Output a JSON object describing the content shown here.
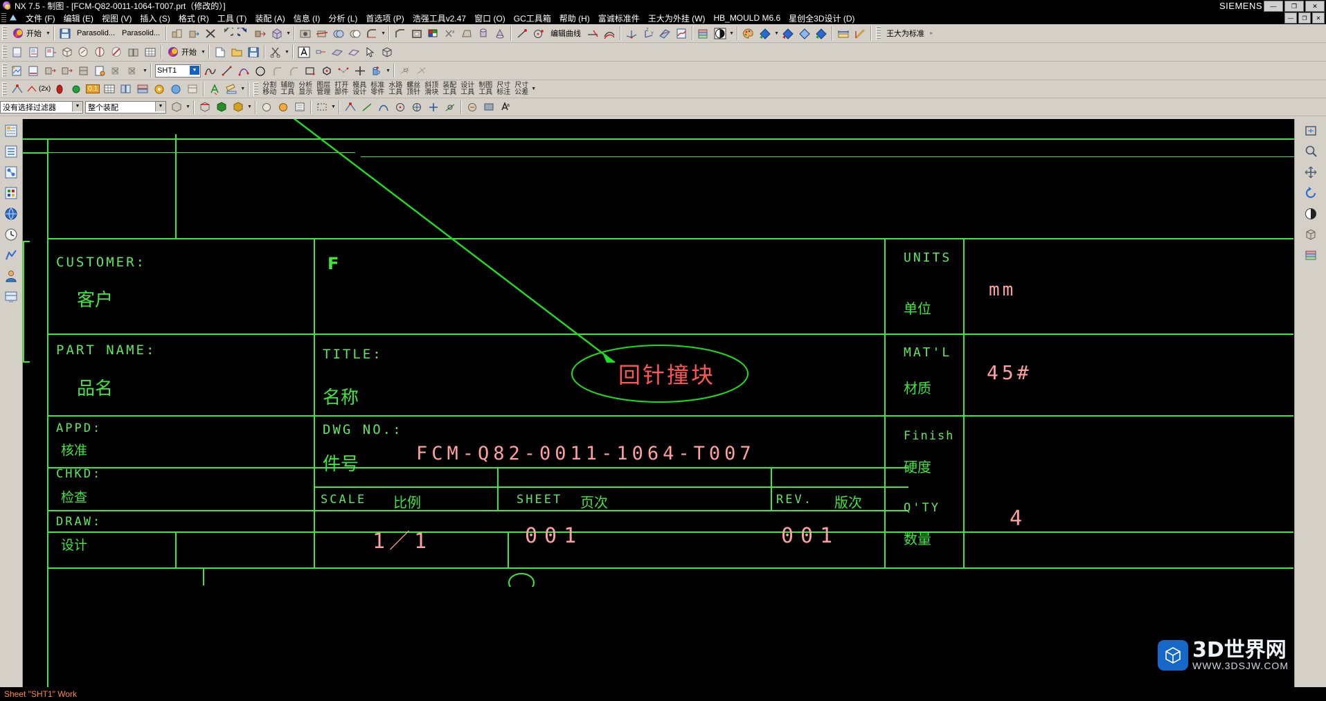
{
  "window": {
    "title": "NX 7.5 - 制图 - [FCM-Q82-0011-1064-T007.prt（修改的）]",
    "brand": "SIEMENS",
    "app_icon": "nx-logo-icon",
    "controls": [
      {
        "name": "minimize-button",
        "glyph": "—"
      },
      {
        "name": "maximize-button",
        "glyph": "❐"
      },
      {
        "name": "close-button",
        "glyph": "✕"
      }
    ],
    "doc_controls": [
      {
        "name": "doc-minimize-button",
        "glyph": "—"
      },
      {
        "name": "doc-restore-button",
        "glyph": "❐"
      },
      {
        "name": "doc-close-button",
        "glyph": "✕"
      }
    ]
  },
  "menubar": {
    "items": [
      {
        "label": "文件 (F)"
      },
      {
        "label": "编辑 (E)"
      },
      {
        "label": "视图 (V)"
      },
      {
        "label": "插入 (S)"
      },
      {
        "label": "格式 (R)"
      },
      {
        "label": "工具 (T)"
      },
      {
        "label": "装配 (A)"
      },
      {
        "label": "信息 (I)"
      },
      {
        "label": "分析 (L)"
      },
      {
        "label": "首选项 (P)"
      },
      {
        "label": "浩强工具v2.47"
      },
      {
        "label": "窗口 (O)"
      },
      {
        "label": "GC工具箱"
      },
      {
        "label": "帮助 (H)"
      },
      {
        "label": "富诚标准件"
      },
      {
        "label": "王大为外挂 (W)"
      },
      {
        "label": "HB_MOULD M6.6"
      },
      {
        "label": "星创全3D设计 (D)"
      }
    ]
  },
  "toolbar_row1": {
    "start_label": "开始",
    "parasolid_1": "Parasolid...",
    "parasolid_2": "Parasolid...",
    "edit_curve_label": "编辑曲线",
    "standard_label": "王大为标准",
    "buttons": [
      {
        "name": "start-menu-button",
        "icon": "nx-start-icon"
      },
      {
        "name": "save-button",
        "icon": "save-icon"
      },
      {
        "name": "parasolid-import-button",
        "icon": "parasolid-icon"
      },
      {
        "name": "parasolid-export-button",
        "icon": "parasolid-icon"
      },
      {
        "name": "assembly-button",
        "icon": "assembly-icon"
      },
      {
        "name": "move-object-button",
        "icon": "move-object-icon"
      },
      {
        "name": "delete-button",
        "icon": "x-delete-icon"
      },
      {
        "name": "undo-button",
        "icon": "undo-icon"
      },
      {
        "name": "redo-button",
        "icon": "redo-icon"
      },
      {
        "name": "extrude-button",
        "icon": "extrude-icon"
      },
      {
        "name": "block-button",
        "icon": "block-icon"
      },
      {
        "name": "hole-button",
        "icon": "hole-icon"
      },
      {
        "name": "trim-body-button",
        "icon": "trim-body-icon"
      },
      {
        "name": "unite-button",
        "icon": "unite-icon"
      },
      {
        "name": "subtract-button",
        "icon": "subtract-icon"
      },
      {
        "name": "edge-blend-button",
        "icon": "blend-icon"
      },
      {
        "name": "chamfer-button",
        "icon": "chamfer-icon"
      },
      {
        "name": "shell-button",
        "icon": "shell-icon"
      },
      {
        "name": "color-button",
        "icon": "color-palette-icon"
      },
      {
        "name": "delete-parameters-button",
        "icon": "xi-icon"
      },
      {
        "name": "taper-button",
        "icon": "taper-icon"
      },
      {
        "name": "cylinder-button",
        "icon": "cylinder-icon"
      },
      {
        "name": "cone-button",
        "icon": "cone-icon"
      },
      {
        "name": "line-button",
        "icon": "line-icon"
      },
      {
        "name": "circle-button",
        "icon": "circle-dot-icon"
      },
      {
        "name": "edit-curve-button",
        "icon": "edit-curve-icon"
      },
      {
        "name": "trim-curve-button",
        "icon": "trim-curve-icon"
      },
      {
        "name": "offset-curve-button",
        "icon": "offset-curve-icon"
      },
      {
        "name": "wcs-button",
        "icon": "wcs-icon"
      },
      {
        "name": "wcs-orient-button",
        "icon": "wcs-orient-icon"
      },
      {
        "name": "sketch-button",
        "icon": "sketch-icon"
      },
      {
        "name": "sketch-curve-button",
        "icon": "sketch-curve-icon"
      },
      {
        "name": "layer-settings-button",
        "icon": "layer-icon"
      },
      {
        "name": "render-style-button",
        "icon": "render-style-icon"
      },
      {
        "name": "palette-button",
        "icon": "palette-icon"
      },
      {
        "name": "section-button",
        "icon": "section-icon"
      },
      {
        "name": "section-2-button",
        "icon": "section2-icon"
      },
      {
        "name": "section-3-button",
        "icon": "section3-icon"
      },
      {
        "name": "section-4-button",
        "icon": "section4-icon"
      },
      {
        "name": "measure-distance-button",
        "icon": "measure-icon"
      },
      {
        "name": "measure-angle-button",
        "icon": "measure-angle-icon"
      }
    ]
  },
  "toolbar_row2": {
    "start_label": "开始",
    "buttons": [
      {
        "name": "new-sheet-button",
        "icon": "new-sheet-icon"
      },
      {
        "name": "view-create-button",
        "icon": "view-create-icon"
      },
      {
        "name": "base-view-button",
        "icon": "base-view-icon"
      },
      {
        "name": "projected-view-button",
        "icon": "projected-view-icon"
      },
      {
        "name": "detail-view-button",
        "icon": "detail-view-icon"
      },
      {
        "name": "section-view-button",
        "icon": "section-view-icon"
      },
      {
        "name": "break-view-button",
        "icon": "break-view-icon"
      },
      {
        "name": "drafting-start-button",
        "icon": "nx-start-icon"
      },
      {
        "name": "new-file-button",
        "icon": "new-file-icon"
      },
      {
        "name": "open-file-button",
        "icon": "open-folder-icon"
      },
      {
        "name": "save-file-button",
        "icon": "save-icon"
      },
      {
        "name": "cut-button",
        "icon": "scissors-icon"
      },
      {
        "name": "annotation-button",
        "icon": "text-a-icon"
      },
      {
        "name": "datum-button",
        "icon": "datum-icon"
      },
      {
        "name": "surface-button",
        "icon": "surface-icon"
      },
      {
        "name": "surface-2-button",
        "icon": "surface2-icon"
      },
      {
        "name": "pointer-button",
        "icon": "pointer-icon"
      },
      {
        "name": "wireframe-button",
        "icon": "wireframe-icon"
      }
    ]
  },
  "toolbar_row3": {
    "sheet_combo_value": "SHT1",
    "buttons": [
      {
        "name": "drawing-sheet-button",
        "icon": "drawing-sheet-icon"
      },
      {
        "name": "view-update-button",
        "icon": "view-update-icon"
      },
      {
        "name": "view-align-button",
        "icon": "view-align-icon"
      },
      {
        "name": "view-boundary-button",
        "icon": "view-boundary-icon"
      },
      {
        "name": "view-style-button",
        "icon": "view-style-icon"
      },
      {
        "name": "view-edit-button",
        "icon": "view-edit-icon"
      },
      {
        "name": "view-delete-button",
        "icon": "view-delete-icon"
      },
      {
        "name": "view-delete2-button",
        "icon": "view-delete2-icon"
      },
      {
        "name": "studio-spline-button",
        "icon": "spline-icon"
      },
      {
        "name": "line-2-button",
        "icon": "line2-icon"
      },
      {
        "name": "arc-button",
        "icon": "arc-icon"
      },
      {
        "name": "circle-2-button",
        "icon": "circle-icon"
      },
      {
        "name": "fillet-button",
        "icon": "fillet-icon"
      },
      {
        "name": "chamfer-2-button",
        "icon": "chamfer2-icon"
      },
      {
        "name": "rectangle-button",
        "icon": "rectangle-icon"
      },
      {
        "name": "polygon-button",
        "icon": "polygon-icon"
      },
      {
        "name": "studio-curve-button",
        "icon": "studio-curve-icon"
      },
      {
        "name": "point-button",
        "icon": "plus-point-icon"
      },
      {
        "name": "extrude-2-button",
        "icon": "extrude-cylinder-icon"
      },
      {
        "name": "trim-sheet-button",
        "icon": "trim-sheet-icon"
      },
      {
        "name": "divide-face-button",
        "icon": "divide-face-icon"
      }
    ]
  },
  "toolbar_row4": {
    "buttons": [
      {
        "name": "snap-point-button",
        "icon": "snap-point-icon"
      },
      {
        "name": "snap-2x-button",
        "icon": "snap-2x-icon",
        "label": "(2x)"
      },
      {
        "name": "snap-end-button",
        "icon": "snap-end-icon"
      },
      {
        "name": "snap-mid-button",
        "icon": "snap-mid-icon"
      },
      {
        "name": "value-01-button",
        "icon": "value-icon",
        "label": "0.1"
      },
      {
        "name": "grid-button",
        "icon": "grid-icon"
      },
      {
        "name": "mold-tools-button",
        "icon": "mold-tools-icon"
      },
      {
        "name": "mold-parting-button",
        "icon": "mold-parting-icon"
      },
      {
        "name": "mold-insert-button",
        "icon": "mold-insert-icon"
      },
      {
        "name": "mold-cool-button",
        "icon": "mold-cool-icon"
      },
      {
        "name": "mold-misc-button",
        "icon": "mold-misc-icon"
      },
      {
        "name": "text-tool-button",
        "icon": "text-a-icon"
      },
      {
        "name": "ruler-tool-button",
        "icon": "ruler-icon"
      }
    ],
    "groups": [
      {
        "name": "group-split-move",
        "top": "分割",
        "bottom": "移动"
      },
      {
        "name": "group-assist-tool",
        "top": "辅助",
        "bottom": "工具"
      },
      {
        "name": "group-analyze-display",
        "top": "分析",
        "bottom": "显示"
      },
      {
        "name": "group-layer-manage",
        "top": "图层",
        "bottom": "管理"
      },
      {
        "name": "group-open-part",
        "top": "打开",
        "bottom": "部件"
      },
      {
        "name": "group-mold-design",
        "top": "模具",
        "bottom": "设计"
      },
      {
        "name": "group-standard-part",
        "top": "标准",
        "bottom": "零件"
      },
      {
        "name": "group-waterline-tool",
        "top": "水路",
        "bottom": "工具"
      },
      {
        "name": "group-screw-ejector",
        "top": "螺丝",
        "bottom": "顶针"
      },
      {
        "name": "group-angle-slider",
        "top": "斜顶",
        "bottom": "滑块"
      },
      {
        "name": "group-assembly-tool",
        "top": "装配",
        "bottom": "工具"
      },
      {
        "name": "group-design-tool",
        "top": "设计",
        "bottom": "工具"
      },
      {
        "name": "group-drafting-tool",
        "top": "制图",
        "bottom": "工具"
      },
      {
        "name": "group-dim-note",
        "top": "尺寸",
        "bottom": "标注"
      },
      {
        "name": "group-dim-tolerance",
        "top": "尺寸",
        "bottom": "公差"
      }
    ]
  },
  "filterbar": {
    "selection_filter_value": "没有选择过滤器",
    "scope_value": "整个装配",
    "buttons": [
      {
        "name": "select-face-button",
        "icon": "select-face-icon"
      },
      {
        "name": "select-edge-button",
        "icon": "select-edge-icon"
      },
      {
        "name": "select-body-button",
        "icon": "select-body-icon"
      },
      {
        "name": "select-feature-button",
        "icon": "select-feature-icon"
      },
      {
        "name": "highlight-button",
        "icon": "highlight-icon"
      },
      {
        "name": "mark-button",
        "icon": "mark-icon"
      },
      {
        "name": "rect-select-button",
        "icon": "rect-select-icon"
      },
      {
        "name": "snap-point-filter-button",
        "icon": "snap-point-icon"
      },
      {
        "name": "snap-line-button",
        "icon": "snap-line-icon"
      },
      {
        "name": "snap-arc-button",
        "icon": "snap-arc-icon"
      },
      {
        "name": "snap-center-button",
        "icon": "snap-center-icon"
      },
      {
        "name": "snap-quad-button",
        "icon": "snap-quad-icon"
      },
      {
        "name": "snap-cross-button",
        "icon": "snap-cross-icon"
      },
      {
        "name": "snap-tangent-button",
        "icon": "snap-tangent-icon"
      },
      {
        "name": "annotation-edit-button",
        "icon": "annotation-edit-icon"
      },
      {
        "name": "display-toggle-button",
        "icon": "display-toggle-icon"
      },
      {
        "name": "text-style-button",
        "icon": "text-style-icon"
      }
    ]
  },
  "left_rail": {
    "items": [
      {
        "name": "rail-assembly-navigator",
        "icon": "assembly-navigator-icon"
      },
      {
        "name": "rail-part-navigator",
        "icon": "part-navigator-icon"
      },
      {
        "name": "rail-constraint-navigator",
        "icon": "constraint-navigator-icon"
      },
      {
        "name": "rail-reuse-library",
        "icon": "reuse-library-icon"
      },
      {
        "name": "rail-web-browser",
        "icon": "web-browser-icon"
      },
      {
        "name": "rail-history",
        "icon": "history-clock-icon"
      },
      {
        "name": "rail-process-studio",
        "icon": "process-studio-icon"
      },
      {
        "name": "rail-role",
        "icon": "role-icon"
      },
      {
        "name": "rail-system-scene",
        "icon": "system-scene-icon"
      }
    ]
  },
  "right_rail": {
    "items": [
      {
        "name": "rail-fit-view",
        "icon": "fit-view-icon"
      },
      {
        "name": "rail-zoom",
        "icon": "zoom-icon"
      },
      {
        "name": "rail-pan",
        "icon": "pan-icon"
      },
      {
        "name": "rail-rotate",
        "icon": "rotate-icon"
      },
      {
        "name": "rail-render-style",
        "icon": "render-style-icon"
      },
      {
        "name": "rail-orientation",
        "icon": "orientation-icon"
      },
      {
        "name": "rail-layer",
        "icon": "layer-icon"
      }
    ]
  },
  "scrollbar": {
    "up_glyph": "▲",
    "down_glyph": "▼"
  },
  "statusbar": {
    "text": "Sheet \"SHT1\" Work"
  },
  "drawing": {
    "title_block": {
      "customer_label": "CUSTOMER:",
      "customer_cn": "客户",
      "part_name_label": "PART NAME:",
      "part_name_cn": "品名",
      "appd_label": "APPD:",
      "appd_cn": "核准",
      "chkd_label": "CHKD:",
      "chkd_cn": "检查",
      "draw_label": "DRAW:",
      "draw_cn": "设计",
      "title_label": "TITLE:",
      "title_cn": "名称",
      "title_value": "回针撞块",
      "dwg_no_label": "DWG NO.:",
      "dwg_no_cn": "件号",
      "dwg_no_value": "FCM-Q82-0011-1064-T007",
      "scale_label": "SCALE",
      "scale_cn": "比例",
      "scale_value": "1／1",
      "sheet_label": "SHEET",
      "sheet_cn": "页次",
      "sheet_value": "001",
      "rev_label": "REV.",
      "rev_cn": "版次",
      "rev_value": "001",
      "units_label": "UNITS",
      "units_cn": "单位",
      "units_value": "mm",
      "matl_label": "MAT'L",
      "matl_cn": "材质",
      "matl_value": "45#",
      "finish_label": "Finish",
      "finish_cn": "硬度",
      "qty_label": "Q'TY",
      "qty_cn": "数量",
      "qty_value": "4",
      "logo_glyph": "F"
    },
    "colors": {
      "line_green": "#3ce83c",
      "text_green": "#5ee85e",
      "text_red": "#ff9f9f",
      "annotation_red": "#ff6666",
      "annotation_green": "#19e019",
      "background": "#000000"
    }
  },
  "watermark": {
    "main": "3D世界网",
    "sub": "WWW.3DSJW.COM",
    "icon": "cube-icon"
  }
}
